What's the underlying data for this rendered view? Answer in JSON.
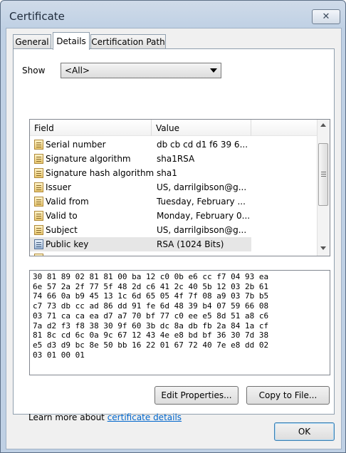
{
  "window": {
    "title": "Certificate",
    "close_symbol": "✕"
  },
  "tabs": [
    {
      "label": "General"
    },
    {
      "label": "Details"
    },
    {
      "label": "Certification Path"
    }
  ],
  "show": {
    "label": "Show",
    "selected": "<All>"
  },
  "list": {
    "columns": [
      "Field",
      "Value"
    ],
    "rows": [
      {
        "field": "Serial number",
        "value": "db cb cd d1 f6 39 6..."
      },
      {
        "field": "Signature algorithm",
        "value": "sha1RSA"
      },
      {
        "field": "Signature hash algorithm",
        "value": "sha1"
      },
      {
        "field": "Issuer",
        "value": "US, darrilgibson@g..."
      },
      {
        "field": "Valid from",
        "value": "Tuesday, February ..."
      },
      {
        "field": "Valid to",
        "value": "Monday, February 0..."
      },
      {
        "field": "Subject",
        "value": "US, darrilgibson@g..."
      },
      {
        "field": "Public key",
        "value": "RSA (1024 Bits)"
      }
    ]
  },
  "value_text": "30 81 89 02 81 81 00 ba 12 c0 0b e6 cc f7 04 93 ea\n6e 57 2a 2f 77 5f 48 2d c6 41 2c 40 5b 12 03 2b 61\n74 66 0a b9 45 13 1c 6d 65 05 4f 7f 08 a9 03 7b b5\nc7 73 db cc ad 86 dd 91 fe 6d 48 39 b4 07 59 66 08\n03 71 ca ca ea d7 a7 70 bf 77 c0 ee e5 8d 51 a8 c6\n7a d2 f3 f8 38 30 9f 60 3b dc 8a db fb 2a 84 1a cf\n81 8c cd 6c 0a 9c 67 12 43 4e e8 bd bf 36 30 7d 38\ne5 d3 d9 bc 8e 50 bb 16 22 01 67 72 40 7e e8 dd 02\n03 01 00 01",
  "buttons": {
    "edit_properties": "Edit Properties...",
    "copy_to_file": "Copy to File...",
    "ok": "OK"
  },
  "learn_more": {
    "prefix": "Learn more about",
    "link": "certificate details"
  }
}
